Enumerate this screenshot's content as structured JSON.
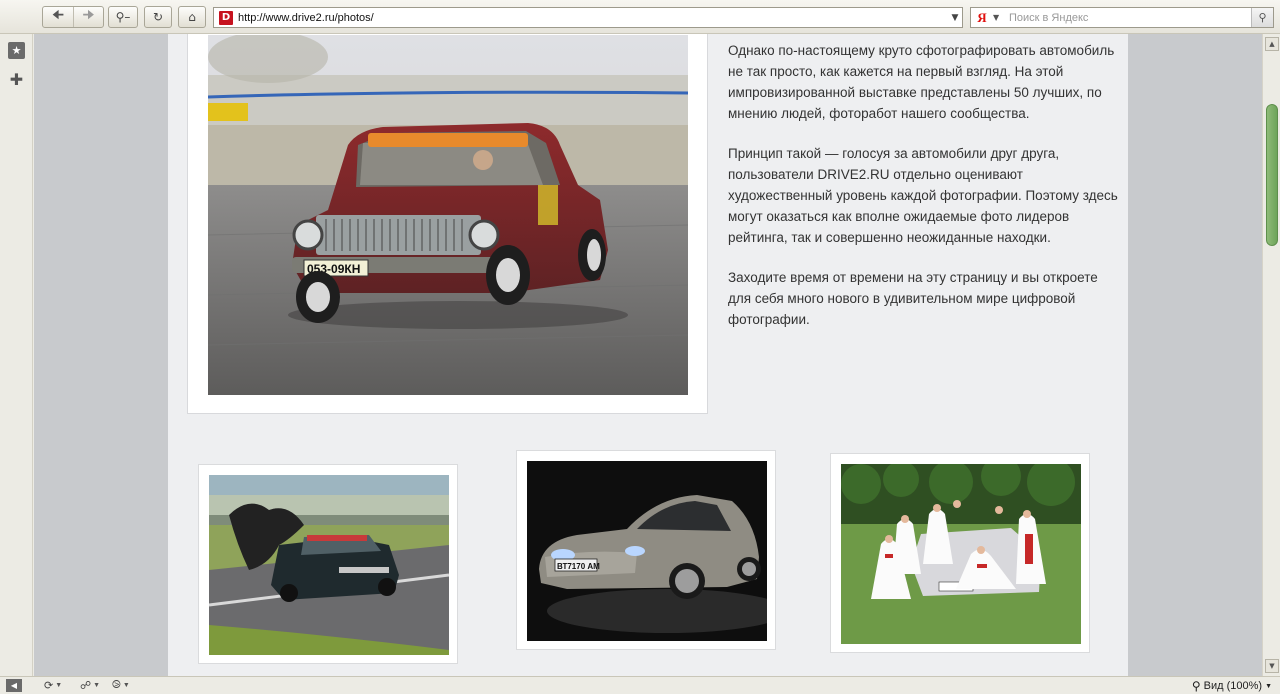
{
  "browser": {
    "address_url": "http://www.drive2.ru/photos/",
    "favicon_letter": "D",
    "search_engine_glyph": "Я",
    "search_placeholder": "Поиск в Яндекс"
  },
  "status_bar": {
    "zoom_label": "Вид (100%)"
  },
  "article": {
    "paragraphs": [
      "Однако по-настоящему круто сфотографировать автомобиль не так просто, как кажется на первый взгляд. На этой импровизированной выставке представлены 50 лучших, по мнению людей, фоторабот нашего сообщества.",
      "Принцип такой — голосуя за автомобили друг друга, пользователи DRIVE2.RU отдельно оценивают художественный уровень каждой фотографии. Поэтому здесь могут оказаться как вполне ожидаемые фото лидеров рейтинга, так и совершенно неожиданные находки.",
      "Заходите время от времени на эту страницу и вы откроете для себя много нового в удивительном мире цифровой фотографии."
    ],
    "main_photo_plate": "053-09КН"
  },
  "thumbnails": [
    {
      "subject": "drift car with parachute"
    },
    {
      "subject": "silver sedan at night",
      "plate": "ВТ7170 АМ"
    },
    {
      "subject": "brides around a car"
    }
  ],
  "colors": {
    "accent_red": "#c6121f",
    "scroll_green": "#7aad62"
  }
}
